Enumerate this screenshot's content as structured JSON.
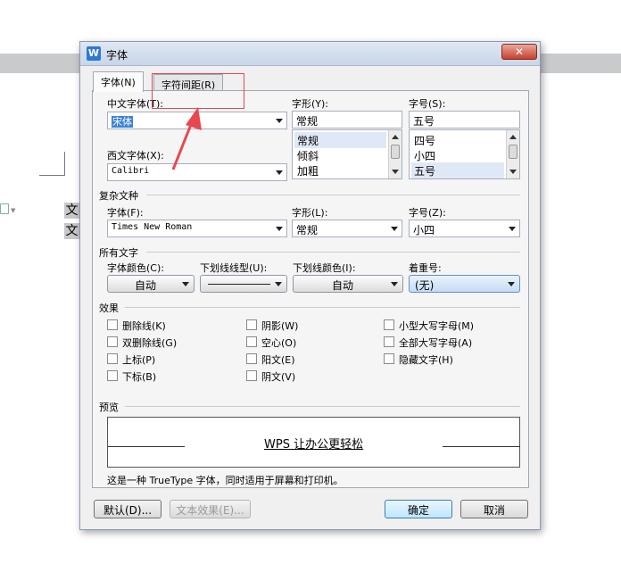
{
  "background": {
    "doc_chars": [
      "文",
      "文"
    ]
  },
  "dialog": {
    "title": "字体",
    "app_icon": "W",
    "close_glyph": "✕",
    "tabs": [
      {
        "label": "字体(N)",
        "active": true
      },
      {
        "label": "字符间距(R)",
        "active": false
      }
    ],
    "chinese_font": {
      "label": "中文字体(T):",
      "value": "宋体"
    },
    "western_font": {
      "label": "西文字体(X):",
      "value": "Calibri"
    },
    "style": {
      "label": "字形(Y):",
      "value": "常规",
      "options": [
        "常规",
        "倾斜",
        "加粗"
      ],
      "selected": "常规"
    },
    "size": {
      "label": "字号(S):",
      "value": "五号",
      "options": [
        "四号",
        "小四",
        "五号"
      ],
      "selected": "五号"
    },
    "complex": {
      "section": "复杂文种",
      "font_label": "字体(F):",
      "font_value": "Times New Roman",
      "style_label": "字形(L):",
      "style_value": "常规",
      "size_label": "字号(Z):",
      "size_value": "小四"
    },
    "all_text": {
      "section": "所有文字",
      "color_label": "字体颜色(C):",
      "color_value": "自动",
      "underline_type_label": "下划线线型(U):",
      "underline_color_label": "下划线颜色(I):",
      "underline_color_value": "自动",
      "emphasis_label": "着重号:",
      "emphasis_value": "(无)"
    },
    "effects": {
      "section": "效果",
      "items": [
        "删除线(K)",
        "双删除线(G)",
        "上标(P)",
        "下标(B)",
        "阴影(W)",
        "空心(O)",
        "阳文(E)",
        "阴文(V)",
        "小型大写字母(M)",
        "全部大写字母(A)",
        "隐藏文字(H)"
      ]
    },
    "preview": {
      "section": "预览",
      "sample": "WPS 让办公更轻松",
      "note": "这是一种 TrueType 字体，同时适用于屏幕和打印机。"
    },
    "buttons": {
      "default": "默认(D)...",
      "text_effect": "文本效果(E)...",
      "ok": "确定",
      "cancel": "取消"
    }
  },
  "colors": {
    "annotation_red": "#e8474f",
    "title_bar": "#d4dfed",
    "selection": "#3b83d6"
  }
}
